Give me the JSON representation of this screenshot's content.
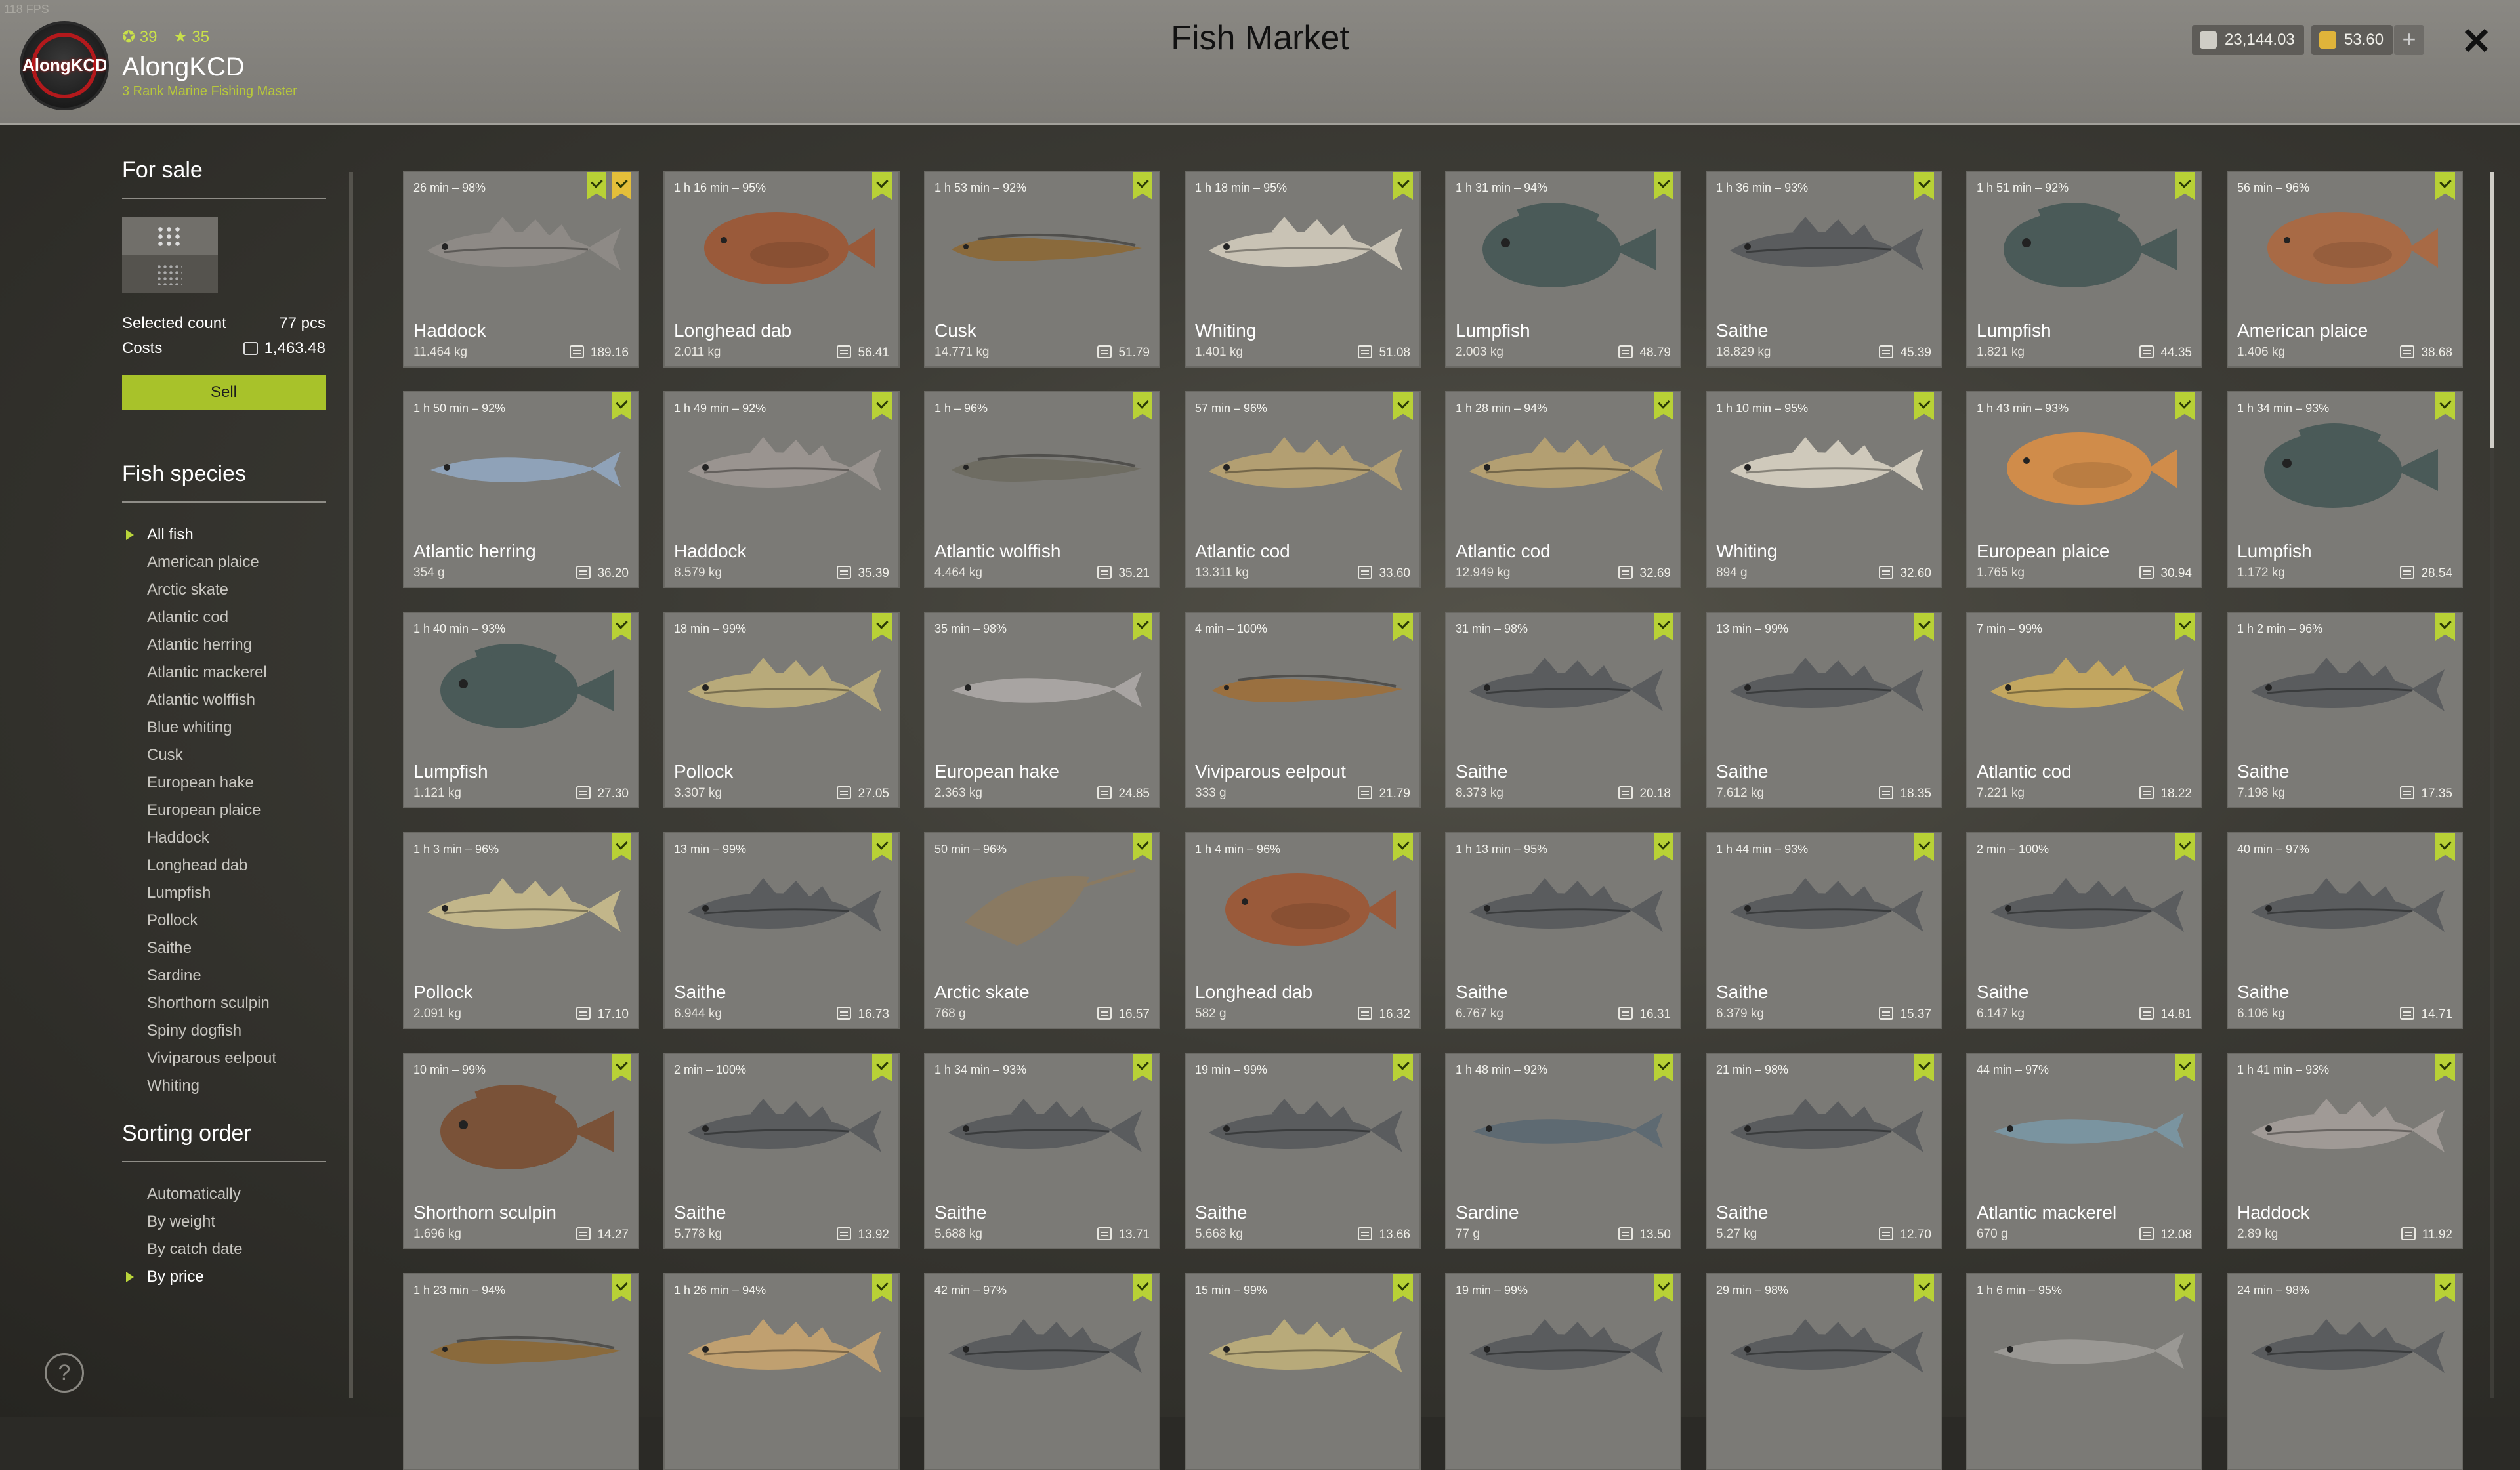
{
  "fps": "118 FPS",
  "player": {
    "name": "AlongKCD",
    "logo_text": "AlongKCD",
    "level": "39",
    "stars": "35",
    "rank": "3 Rank Marine Fishing Master"
  },
  "title": "Fish Market",
  "currency": {
    "silver": "23,144.03",
    "gold": "53.60",
    "add": "+"
  },
  "close": "✕",
  "sidebar": {
    "for_sale": "For sale",
    "selected_count_label": "Selected count",
    "selected_count": "77 pcs",
    "costs_label": "Costs",
    "costs": "1,463.48",
    "sell": "Sell",
    "species_title": "Fish species",
    "species": [
      "All fish",
      "American plaice",
      "Arctic skate",
      "Atlantic cod",
      "Atlantic herring",
      "Atlantic mackerel",
      "Atlantic wolffish",
      "Blue whiting",
      "Cusk",
      "European hake",
      "European plaice",
      "Haddock",
      "Longhead dab",
      "Lumpfish",
      "Pollock",
      "Saithe",
      "Sardine",
      "Shorthorn sculpin",
      "Spiny dogfish",
      "Viviparous eelpout",
      "Whiting"
    ],
    "sort_title": "Sorting order",
    "sort": [
      "Automatically",
      "By weight",
      "By catch date",
      "By price"
    ]
  },
  "help": "?",
  "fish": [
    {
      "time": "26 min – 98%",
      "name": "Haddock",
      "weight": "11.464 kg",
      "price": "189.16",
      "type": "cod",
      "color": "#8e8a86",
      "fav": true
    },
    {
      "time": "1 h 16 min – 95%",
      "name": "Longhead dab",
      "weight": "2.011 kg",
      "price": "56.41",
      "type": "flat",
      "color": "#9a5a3a"
    },
    {
      "time": "1 h 53 min – 92%",
      "name": "Cusk",
      "weight": "14.771 kg",
      "price": "51.79",
      "type": "eel",
      "color": "#8a6a3c"
    },
    {
      "time": "1 h 18 min – 95%",
      "name": "Whiting",
      "weight": "1.401 kg",
      "price": "51.08",
      "type": "cod",
      "color": "#c9c3b5"
    },
    {
      "time": "1 h 31 min – 94%",
      "name": "Lumpfish",
      "weight": "2.003 kg",
      "price": "48.79",
      "type": "lump",
      "color": "#4a5a58"
    },
    {
      "time": "1 h 36 min – 93%",
      "name": "Saithe",
      "weight": "18.829 kg",
      "price": "45.39",
      "type": "cod",
      "color": "#5a5c5e"
    },
    {
      "time": "1 h 51 min – 92%",
      "name": "Lumpfish",
      "weight": "1.821 kg",
      "price": "44.35",
      "type": "lump",
      "color": "#4a5a58"
    },
    {
      "time": "56 min – 96%",
      "name": "American plaice",
      "weight": "1.406 kg",
      "price": "38.68",
      "type": "flat",
      "color": "#a86a45"
    },
    {
      "time": "1 h 50 min – 92%",
      "name": "Atlantic herring",
      "weight": "354 g",
      "price": "36.20",
      "type": "slim",
      "color": "#8fa2b8"
    },
    {
      "time": "1 h 49 min – 92%",
      "name": "Haddock",
      "weight": "8.579 kg",
      "price": "35.39",
      "type": "cod",
      "color": "#9a9490"
    },
    {
      "time": "1 h – 96%",
      "name": "Atlantic wolffish",
      "weight": "4.464 kg",
      "price": "35.21",
      "type": "eel",
      "color": "#6e6c62"
    },
    {
      "time": "57 min – 96%",
      "name": "Atlantic cod",
      "weight": "13.311 kg",
      "price": "33.60",
      "type": "cod",
      "color": "#b39f72"
    },
    {
      "time": "1 h 28 min – 94%",
      "name": "Atlantic cod",
      "weight": "12.949 kg",
      "price": "32.69",
      "type": "cod",
      "color": "#b39f72"
    },
    {
      "time": "1 h 10 min – 95%",
      "name": "Whiting",
      "weight": "894 g",
      "price": "32.60",
      "type": "cod",
      "color": "#cfc9bb"
    },
    {
      "time": "1 h 43 min – 93%",
      "name": "European plaice",
      "weight": "1.765 kg",
      "price": "30.94",
      "type": "flat",
      "color": "#d08c4a"
    },
    {
      "time": "1 h 34 min – 93%",
      "name": "Lumpfish",
      "weight": "1.172 kg",
      "price": "28.54",
      "type": "lump",
      "color": "#4a5a58"
    },
    {
      "time": "1 h 40 min – 93%",
      "name": "Lumpfish",
      "weight": "1.121 kg",
      "price": "27.30",
      "type": "lump",
      "color": "#4a5a58"
    },
    {
      "time": "18 min – 99%",
      "name": "Pollock",
      "weight": "3.307 kg",
      "price": "27.05",
      "type": "cod",
      "color": "#b8aa7a"
    },
    {
      "time": "35 min – 98%",
      "name": "European hake",
      "weight": "2.363 kg",
      "price": "24.85",
      "type": "slim",
      "color": "#a8a4a2"
    },
    {
      "time": "4 min – 100%",
      "name": "Viviparous eelpout",
      "weight": "333 g",
      "price": "21.79",
      "type": "eel",
      "color": "#9a7040"
    },
    {
      "time": "31 min – 98%",
      "name": "Saithe",
      "weight": "8.373 kg",
      "price": "20.18",
      "type": "cod",
      "color": "#5a5c5e"
    },
    {
      "time": "13 min – 99%",
      "name": "Saithe",
      "weight": "7.612 kg",
      "price": "18.35",
      "type": "cod",
      "color": "#5a5c5e"
    },
    {
      "time": "7 min – 99%",
      "name": "Atlantic cod",
      "weight": "7.221 kg",
      "price": "18.22",
      "type": "cod",
      "color": "#c2a660"
    },
    {
      "time": "1 h 2 min – 96%",
      "name": "Saithe",
      "weight": "7.198 kg",
      "price": "17.35",
      "type": "cod",
      "color": "#5a5c5e"
    },
    {
      "time": "1 h 3 min – 96%",
      "name": "Pollock",
      "weight": "2.091 kg",
      "price": "17.10",
      "type": "cod",
      "color": "#c2b68a"
    },
    {
      "time": "13 min – 99%",
      "name": "Saithe",
      "weight": "6.944 kg",
      "price": "16.73",
      "type": "cod",
      "color": "#5a5c5e"
    },
    {
      "time": "50 min – 96%",
      "name": "Arctic skate",
      "weight": "768 g",
      "price": "16.57",
      "type": "skate",
      "color": "#8a7a62"
    },
    {
      "time": "1 h 4 min – 96%",
      "name": "Longhead dab",
      "weight": "582 g",
      "price": "16.32",
      "type": "flat",
      "color": "#9a5a3a"
    },
    {
      "time": "1 h 13 min – 95%",
      "name": "Saithe",
      "weight": "6.767 kg",
      "price": "16.31",
      "type": "cod",
      "color": "#5a5c5e"
    },
    {
      "time": "1 h 44 min – 93%",
      "name": "Saithe",
      "weight": "6.379 kg",
      "price": "15.37",
      "type": "cod",
      "color": "#5a5c5e"
    },
    {
      "time": "2 min – 100%",
      "name": "Saithe",
      "weight": "6.147 kg",
      "price": "14.81",
      "type": "cod",
      "color": "#5a5c5e"
    },
    {
      "time": "40 min – 97%",
      "name": "Saithe",
      "weight": "6.106 kg",
      "price": "14.71",
      "type": "cod",
      "color": "#5a5c5e"
    },
    {
      "time": "10 min – 99%",
      "name": "Shorthorn sculpin",
      "weight": "1.696 kg",
      "price": "14.27",
      "type": "lump",
      "color": "#7a5238"
    },
    {
      "time": "2 min – 100%",
      "name": "Saithe",
      "weight": "5.778 kg",
      "price": "13.92",
      "type": "cod",
      "color": "#5a5c5e"
    },
    {
      "time": "1 h 34 min – 93%",
      "name": "Saithe",
      "weight": "5.688 kg",
      "price": "13.71",
      "type": "cod",
      "color": "#5a5c5e"
    },
    {
      "time": "19 min – 99%",
      "name": "Saithe",
      "weight": "5.668 kg",
      "price": "13.66",
      "type": "cod",
      "color": "#5a5c5e"
    },
    {
      "time": "1 h 48 min – 92%",
      "name": "Sardine",
      "weight": "77 g",
      "price": "13.50",
      "type": "slim",
      "color": "#5e6a72"
    },
    {
      "time": "21 min – 98%",
      "name": "Saithe",
      "weight": "5.27 kg",
      "price": "12.70",
      "type": "cod",
      "color": "#5a5c5e"
    },
    {
      "time": "44 min – 97%",
      "name": "Atlantic mackerel",
      "weight": "670 g",
      "price": "12.08",
      "type": "slim",
      "color": "#7a94a0"
    },
    {
      "time": "1 h 41 min – 93%",
      "name": "Haddock",
      "weight": "2.89 kg",
      "price": "11.92",
      "type": "cod",
      "color": "#a09a96"
    },
    {
      "time": "1 h 23 min – 94%",
      "name": "",
      "weight": "",
      "price": "",
      "type": "eel",
      "color": "#8a6a3c"
    },
    {
      "time": "1 h 26 min – 94%",
      "name": "",
      "weight": "",
      "price": "",
      "type": "cod",
      "color": "#c0a070"
    },
    {
      "time": "42 min – 97%",
      "name": "",
      "weight": "",
      "price": "",
      "type": "cod",
      "color": "#5a5c5e"
    },
    {
      "time": "15 min – 99%",
      "name": "",
      "weight": "",
      "price": "",
      "type": "cod",
      "color": "#b8aa7a"
    },
    {
      "time": "19 min – 99%",
      "name": "",
      "weight": "",
      "price": "",
      "type": "cod",
      "color": "#5a5c5e"
    },
    {
      "time": "29 min – 98%",
      "name": "",
      "weight": "",
      "price": "",
      "type": "cod",
      "color": "#5a5c5e"
    },
    {
      "time": "1 h 6 min – 95%",
      "name": "",
      "weight": "",
      "price": "",
      "type": "slim",
      "color": "#9a9894"
    },
    {
      "time": "24 min – 98%",
      "name": "",
      "weight": "",
      "price": "",
      "type": "cod",
      "color": "#5a5c5e"
    }
  ]
}
